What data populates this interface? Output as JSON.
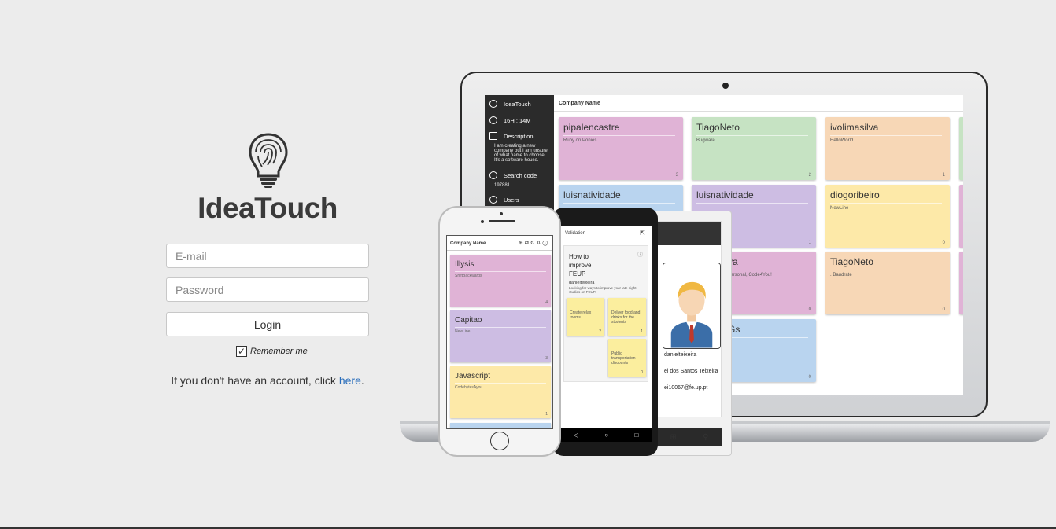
{
  "login": {
    "brand": "IdeaTouch",
    "email_placeholder": "E-mail",
    "password_placeholder": "Password",
    "login_label": "Login",
    "remember_label": "Remember me",
    "signup_text": "If you don't have an account, click ",
    "signup_link": "here",
    "signup_end": "."
  },
  "laptop": {
    "sidebar": {
      "app": "IdeaTouch",
      "time": "16H : 14M",
      "description_label": "Description",
      "description": "I am creating a new company but I am unsure of what name to choose. It's a software house.",
      "search_label": "Search code",
      "search_code": "197881",
      "users_label": "Users"
    },
    "title": "Company Name",
    "cards": [
      {
        "title": "pipalencastre",
        "sub": "Ruby on Ponies",
        "count": "3",
        "color": "pink"
      },
      {
        "title": "TiagoNeto",
        "sub": "Bugware",
        "count": "2",
        "color": "green"
      },
      {
        "title": "ivolimasilva",
        "sub": "HelloWorld",
        "count": "1",
        "color": "orange"
      },
      {
        "title": "luisnatividade",
        "sub": "",
        "count": "",
        "color": "blue"
      },
      {
        "title": "luisnatividade",
        "sub": "",
        "count": "1",
        "color": "purple"
      },
      {
        "title": "diogoribeiro",
        "sub": "NewLine",
        "count": "0",
        "color": "yellow"
      },
      {
        "title": "va",
        "sub": "personal, Code4You!",
        "count": "0",
        "color": "pink"
      },
      {
        "title": "TiagoNeto",
        "sub": ". Baudrate",
        "count": "0",
        "color": "orange"
      },
      {
        "title": "Gs",
        "sub": "",
        "count": "0",
        "color": "blue"
      }
    ]
  },
  "windows_phone": {
    "user": "danielteixeira",
    "name": "el dos Santos Teixeira",
    "email": "ei10067@fe.up.pt"
  },
  "android": {
    "title": "Validation",
    "idea_title": "How to improve FEUP",
    "author": "danielteixeira",
    "desc": "Looking for ways to improve your late night studies on FEUP.",
    "notes": [
      {
        "text": "Create relax rooms.",
        "count": "2"
      },
      {
        "text": "Deliver food and drinks for the students",
        "count": "1"
      },
      {
        "text": "Public transportation discounts",
        "count": "0"
      }
    ]
  },
  "iphone": {
    "title": "Company Name",
    "cards": [
      {
        "title": "Illysis",
        "sub": "ShiftBackwards",
        "count": "4",
        "color": "pink"
      },
      {
        "title": "Capitao",
        "sub": "NewLine",
        "count": "3",
        "color": "purple"
      },
      {
        "title": "Javascript",
        "sub": "CodebytesAyou",
        "count": "1",
        "color": "yellow"
      }
    ]
  }
}
